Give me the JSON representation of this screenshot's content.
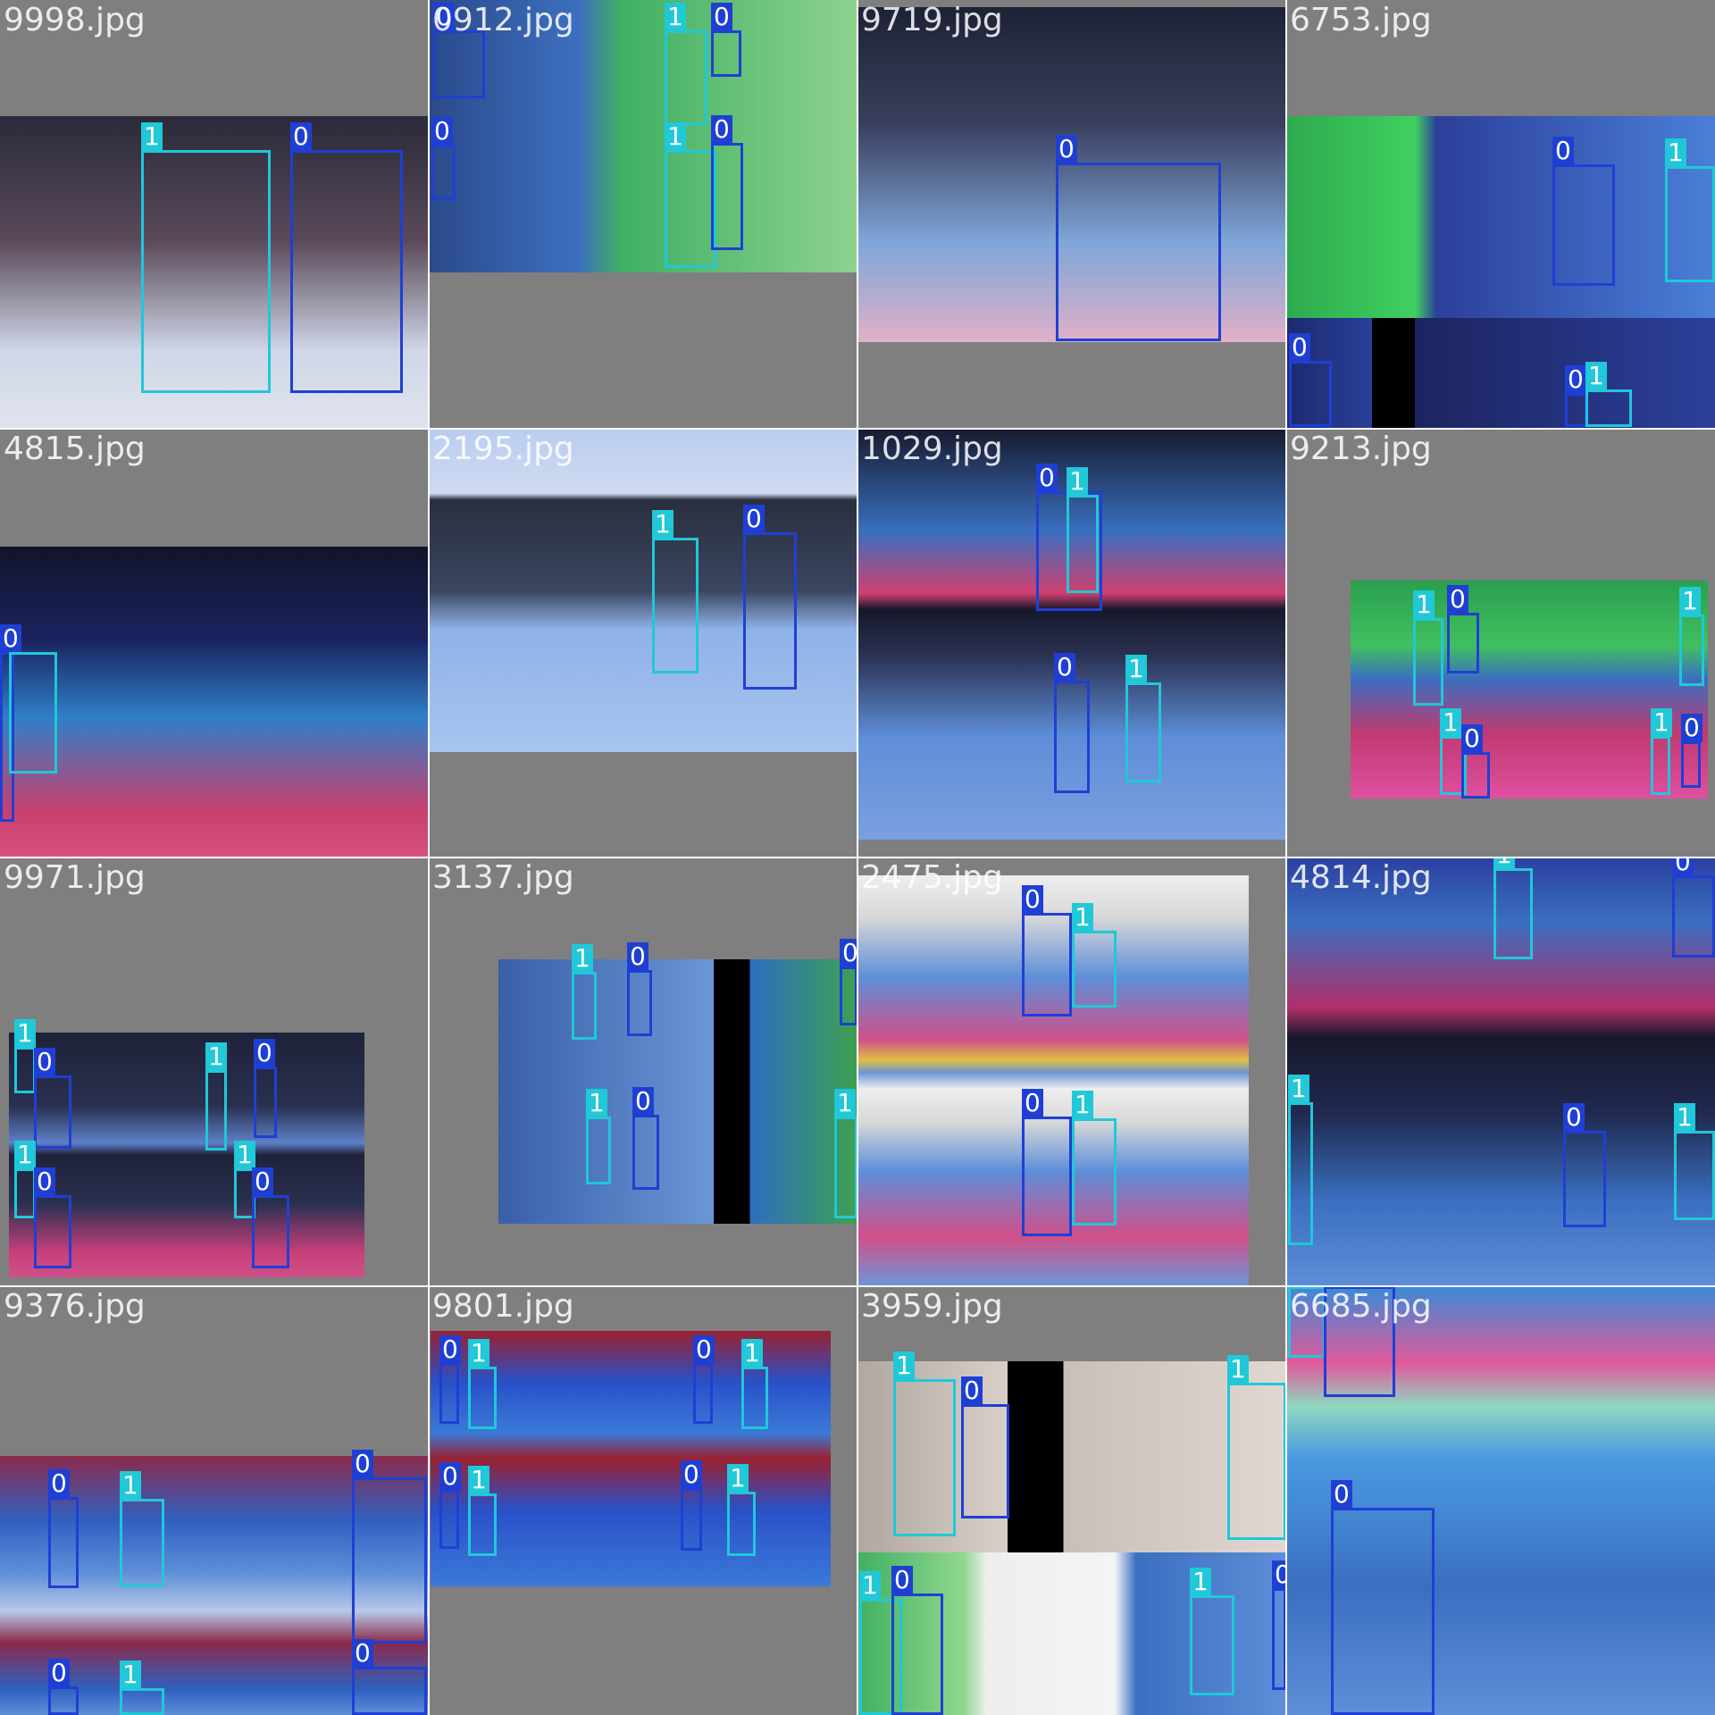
{
  "colors": {
    "class_0": "#1f3fd4",
    "class_1": "#20c8d8",
    "background": "#808080"
  },
  "class_labels": {
    "c0": "0",
    "c1": "1"
  },
  "tiles": [
    {
      "filename": "9998.jpg"
    },
    {
      "filename": "0912.jpg"
    },
    {
      "filename": "9719.jpg"
    },
    {
      "filename": "6753.jpg"
    },
    {
      "filename": "4815.jpg"
    },
    {
      "filename": "2195.jpg"
    },
    {
      "filename": "1029.jpg"
    },
    {
      "filename": "9213.jpg"
    },
    {
      "filename": "9971.jpg"
    },
    {
      "filename": "3137.jpg"
    },
    {
      "filename": "2475.jpg"
    },
    {
      "filename": "4814.jpg"
    },
    {
      "filename": "9376.jpg"
    },
    {
      "filename": "9801.jpg"
    },
    {
      "filename": "3959.jpg"
    },
    {
      "filename": "6685.jpg"
    }
  ]
}
